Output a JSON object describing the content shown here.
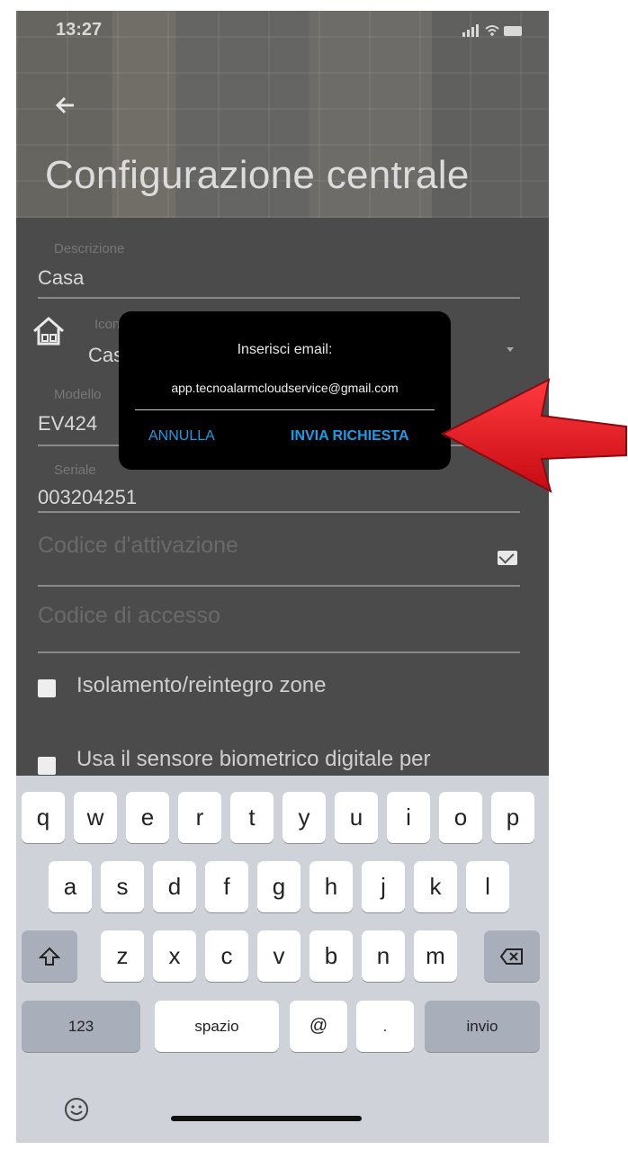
{
  "status": {
    "time": "13:27"
  },
  "header": {
    "title": "Configurazione centrale"
  },
  "form": {
    "descrizione": {
      "label": "Descrizione",
      "value": "Casa"
    },
    "icona": {
      "label": "Icona",
      "value": "Casa"
    },
    "modello": {
      "label": "Modello",
      "value": "EV424"
    },
    "seriale": {
      "label": "Seriale",
      "value": "003204251"
    },
    "codice_attivazione": {
      "placeholder": "Codice d'attivazione"
    },
    "codice_accesso": {
      "placeholder": "Codice di accesso"
    },
    "isolamento": {
      "label": "Isolamento/reintegro zone"
    },
    "biometrico": {
      "label": "Usa il sensore biometrico digitale per"
    }
  },
  "dialog": {
    "title": "Inserisci email:",
    "email": "app.tecnoalarmcloudservice@gmail.com",
    "cancel": "ANNULLA",
    "send": "INVIA RICHIESTA"
  },
  "keyboard": {
    "row1": [
      "q",
      "w",
      "e",
      "r",
      "t",
      "y",
      "u",
      "i",
      "o",
      "p"
    ],
    "row2": [
      "a",
      "s",
      "d",
      "f",
      "g",
      "h",
      "j",
      "k",
      "l"
    ],
    "row3": [
      "z",
      "x",
      "c",
      "v",
      "b",
      "n",
      "m"
    ],
    "num": "123",
    "space": "spazio",
    "at": "@",
    "dot": ".",
    "enter": "invio"
  },
  "colors": {
    "accent": "#1e9be6",
    "arrow": "#e0141c"
  },
  "icons": [
    "back-arrow-icon",
    "house-icon",
    "dropdown-icon",
    "mail-icon",
    "shift-icon",
    "backspace-icon",
    "emoji-icon"
  ]
}
